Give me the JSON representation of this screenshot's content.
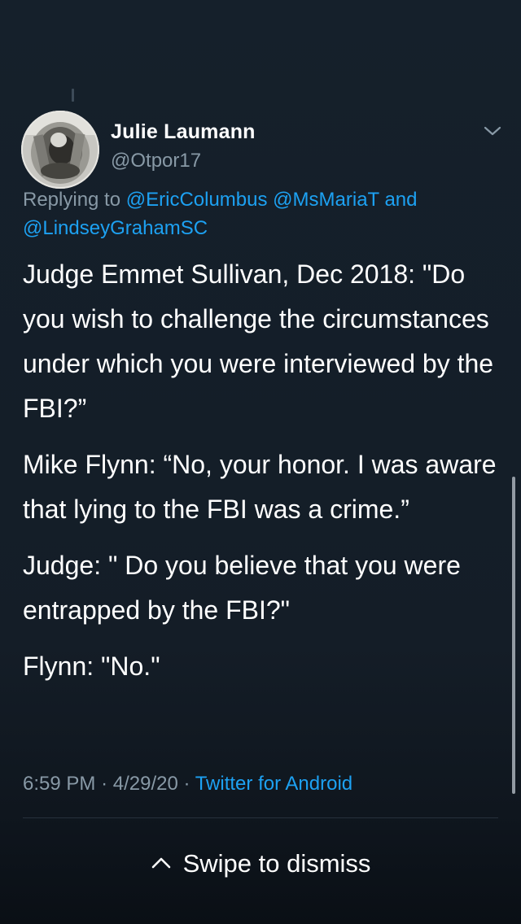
{
  "tweet": {
    "author_name": "Julie Laumann",
    "author_handle": "@Otpor17",
    "reply_prefix": "Replying to",
    "reply_mention_1": "@EricColumbus",
    "reply_mention_2": "@MsMariaT",
    "reply_conjunction": "and",
    "reply_mention_3": "@LindseyGrahamSC",
    "paragraphs": [
      "Judge Emmet Sullivan, Dec 2018: \"Do you wish to challenge the circumstances under which you were interviewed by the FBI?”",
      "Mike Flynn: “No, your honor. I was aware that lying to the FBI was a crime.”",
      "Judge: \" Do you believe that you were entrapped by the FBI?\"",
      "Flynn: \"No.\""
    ],
    "time": "6:59 PM",
    "date": "4/29/20",
    "separator": "·",
    "source": "Twitter for Android"
  },
  "footer": {
    "dismiss_label": "Swipe to dismiss"
  },
  "colors": {
    "background": "#15202b",
    "secondary_text": "#8899a6",
    "link": "#1da1f2"
  },
  "icons": {
    "more": "chevron-down-icon",
    "dismiss": "chevron-up-icon"
  }
}
